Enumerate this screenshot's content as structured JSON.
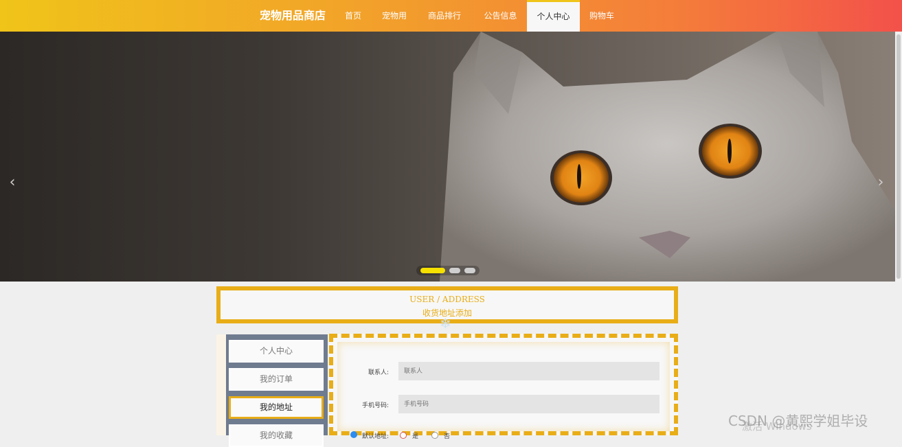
{
  "nav": {
    "brand": "宠物用品商店",
    "items": [
      {
        "label": "首页"
      },
      {
        "label": "宠物用品"
      },
      {
        "label": "商品排行榜"
      },
      {
        "label": "公告信息"
      },
      {
        "label": "个人中心",
        "active": true
      },
      {
        "label": "购物车"
      }
    ]
  },
  "banner": {
    "prev_icon": "chevron-left-icon",
    "next_icon": "chevron-right-icon",
    "slide_count": 3,
    "active_slide": 1
  },
  "section": {
    "title_en": "USER / ADDRESS",
    "title_cn": "收货地址添加"
  },
  "side_menu": [
    {
      "label": "个人中心"
    },
    {
      "label": "我的订单"
    },
    {
      "label": "我的地址",
      "active": true
    },
    {
      "label": "我的收藏"
    }
  ],
  "form": {
    "contact_label": "联系人:",
    "contact_placeholder": "联系人",
    "phone_label": "手机号码:",
    "phone_placeholder": "手机号码",
    "default_label": "默认地址:",
    "yes_label": "是",
    "no_label": "否"
  },
  "watermark": "CSDN @黄熙学姐毕设",
  "os_notice": "激活 Windows",
  "colors": {
    "accent": "#e8ad17",
    "nav_start": "#f0c419",
    "nav_end": "#f3514a",
    "side_bg": "#6f7b8f"
  }
}
